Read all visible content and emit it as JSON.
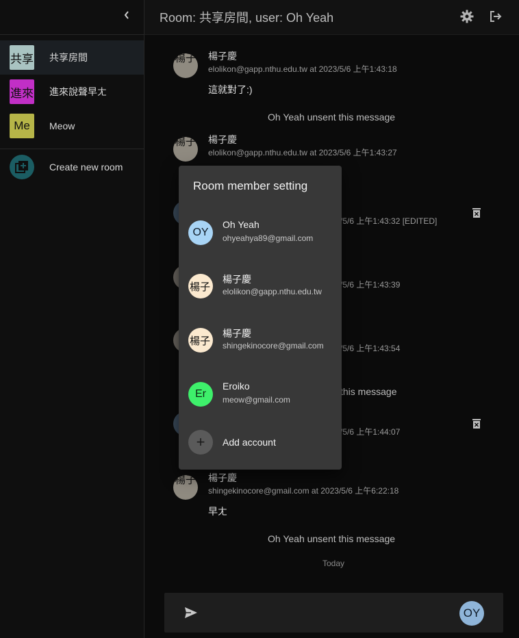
{
  "sidebar": {
    "collapse_glyph": "‹",
    "rooms": [
      {
        "abbr": "共享",
        "name": "共享房間",
        "color": "#a9c4c2"
      },
      {
        "abbr": "進來",
        "name": "進來說聲早ㄤ",
        "color": "#c12fc6"
      },
      {
        "abbr": "Me",
        "name": "Meow",
        "color": "#b6b548"
      }
    ],
    "create_label": "Create new room"
  },
  "header": {
    "title": "Room: 共享房間, user: Oh Yeah",
    "settings_icon": "gear-icon",
    "logout_icon": "logout-icon"
  },
  "messages": [
    {
      "avatar": "楊子",
      "name": "楊子慶",
      "meta": "elolikon@gapp.nthu.edu.tw at 2023/5/6 上午1:43:18",
      "text": "這就對了:)"
    },
    {
      "avatar": "楊子",
      "name": "楊子慶",
      "meta": "elolikon@gapp.nthu.edu.tw at 2023/5/6 上午1:43:27",
      "text": ""
    },
    {
      "avatar": "楊子",
      "name": "楊子慶",
      "meta": "shingekinocore@gmail.com at 2023/5/6 上午6:22:18",
      "text": "早ㄤ"
    }
  ],
  "partial_meta": [
    "/5/6 上午1:43:32 [EDITED]",
    "/5/6 上午1:43:39",
    "/5/6 上午1:43:54",
    "/5/6 上午1:44:07"
  ],
  "system_messages": {
    "unsent_1": "Oh Yeah unsent this message",
    "unsent_partial": "this message",
    "unsent_3": "Oh Yeah unsent this message"
  },
  "day_separator": "Today",
  "composer": {
    "placeholder": "",
    "user_initials": "OY"
  },
  "modal": {
    "title": "Room member setting",
    "members": [
      {
        "initials": "OY",
        "name": "Oh Yeah",
        "email": "ohyeahya89@gmail.com",
        "color": "#a8d4f5"
      },
      {
        "initials": "楊子",
        "name": "楊子慶",
        "email": "elolikon@gapp.nthu.edu.tw",
        "color": "#fbe9cf"
      },
      {
        "initials": "楊子",
        "name": "楊子慶",
        "email": "shingekinocore@gmail.com",
        "color": "#fbe9cf"
      },
      {
        "initials": "Er",
        "name": "Eroiko",
        "email": "meow@gmail.com",
        "color": "#3ef06b"
      }
    ],
    "add_label": "Add account",
    "add_glyph": "+"
  }
}
